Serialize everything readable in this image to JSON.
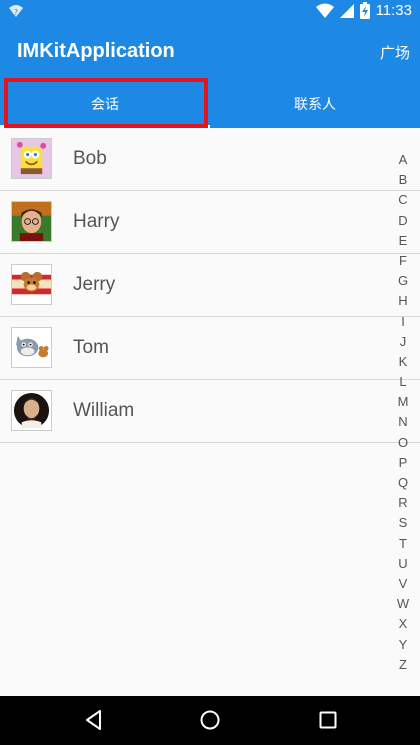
{
  "status_bar": {
    "time": "11:33",
    "icons": [
      "wifi-question-icon",
      "wifi-icon",
      "signal-icon",
      "battery-icon"
    ]
  },
  "app_bar": {
    "title": "IMKitApplication",
    "action_label": "广场"
  },
  "tabs": [
    {
      "label": "会话",
      "selected": true
    },
    {
      "label": "联系人",
      "selected": false
    }
  ],
  "contacts": [
    {
      "name": "Bob",
      "avatar": "spongebob-avatar"
    },
    {
      "name": "Harry",
      "avatar": "harry-avatar"
    },
    {
      "name": "Jerry",
      "avatar": "jerry-avatar"
    },
    {
      "name": "Tom",
      "avatar": "tom-avatar"
    },
    {
      "name": "William",
      "avatar": "william-avatar"
    }
  ],
  "alphabet_index": [
    "A",
    "B",
    "C",
    "D",
    "E",
    "F",
    "G",
    "H",
    "I",
    "J",
    "K",
    "L",
    "M",
    "N",
    "O",
    "P",
    "Q",
    "R",
    "S",
    "T",
    "U",
    "V",
    "W",
    "X",
    "Y",
    "Z"
  ],
  "colors": {
    "primary": "#1e88e5",
    "highlight": "#e0151f",
    "background": "#fafafa",
    "text": "#555555"
  }
}
